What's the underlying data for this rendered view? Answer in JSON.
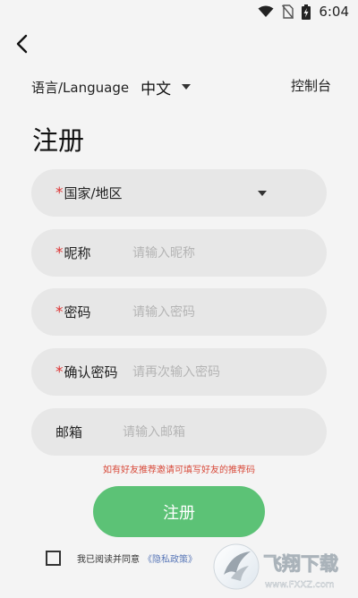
{
  "status_bar": {
    "time": "6:04"
  },
  "language": {
    "label": "语言/Language",
    "value": "中文"
  },
  "console_label": "控制台",
  "page_title": "注册",
  "fields": {
    "region": {
      "label": "国家/地区"
    },
    "nickname": {
      "label": "昵称",
      "placeholder": "请输入昵称"
    },
    "password": {
      "label": "密码",
      "placeholder": "请输入密码"
    },
    "confirm_password": {
      "label": "确认密码",
      "placeholder": "请再次输入密码"
    },
    "email": {
      "label": "邮箱",
      "placeholder": "请输入邮箱"
    }
  },
  "required_mark": "*",
  "referral_hint": "如有好友推荐邀请可填写好友的推荐码",
  "submit_label": "注册",
  "agreement": {
    "text": "我已阅读并同意",
    "policy_link": "《隐私政策》"
  },
  "watermark": {
    "main": "飞翔下载",
    "url": "www.FXXZ.com"
  },
  "colors": {
    "accent": "#5cc276",
    "required": "#d33333",
    "hint": "#d84a3a",
    "link": "#5a78b8"
  }
}
